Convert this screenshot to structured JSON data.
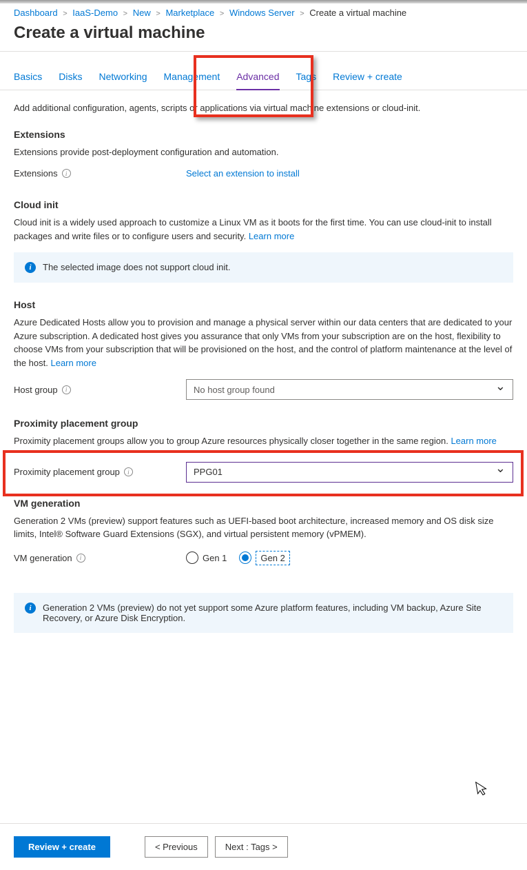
{
  "breadcrumb": {
    "items": [
      "Dashboard",
      "IaaS-Demo",
      "New",
      "Marketplace",
      "Windows Server"
    ],
    "current": "Create a virtual machine"
  },
  "page_title": "Create a virtual machine",
  "tabs": {
    "basics": "Basics",
    "disks": "Disks",
    "networking": "Networking",
    "management": "Management",
    "advanced": "Advanced",
    "tags": "Tags",
    "review": "Review + create"
  },
  "intro": "Add additional configuration, agents, scripts or applications via virtual machine extensions or cloud-init.",
  "extensions": {
    "heading": "Extensions",
    "desc": "Extensions provide post-deployment configuration and automation.",
    "label": "Extensions",
    "action": "Select an extension to install"
  },
  "cloud_init": {
    "heading": "Cloud init",
    "desc": "Cloud init is a widely used approach to customize a Linux VM as it boots for the first time. You can use cloud-init to install packages and write files or to configure users and security.  ",
    "learn_more": "Learn more",
    "banner": "The selected image does not support cloud init."
  },
  "host": {
    "heading": "Host",
    "desc": "Azure Dedicated Hosts allow you to provision and manage a physical server within our data centers that are dedicated to your Azure subscription. A dedicated host gives you assurance that only VMs from your subscription are on the host, flexibility to choose VMs from your subscription that will be provisioned on the host, and the control of platform maintenance at the level of the host.  ",
    "learn_more": "Learn more",
    "label": "Host group",
    "placeholder": "No host group found"
  },
  "ppg": {
    "heading": "Proximity placement group",
    "desc": "Proximity placement groups allow you to group Azure resources physically closer together in the same region.  ",
    "learn_more": "Learn more",
    "label": "Proximity placement group",
    "value": "PPG01"
  },
  "vmgen": {
    "heading": "VM generation",
    "desc": "Generation 2 VMs (preview) support features such as UEFI-based boot architecture, increased memory and OS disk size limits, Intel® Software Guard Extensions (SGX), and virtual persistent memory (vPMEM).",
    "label": "VM generation",
    "gen1": "Gen 1",
    "gen2": "Gen 2",
    "banner": "Generation 2 VMs (preview) do not yet support some Azure platform features, including VM backup, Azure Site Recovery, or Azure Disk Encryption."
  },
  "footer": {
    "review": "Review + create",
    "previous": "< Previous",
    "next": "Next : Tags >"
  }
}
